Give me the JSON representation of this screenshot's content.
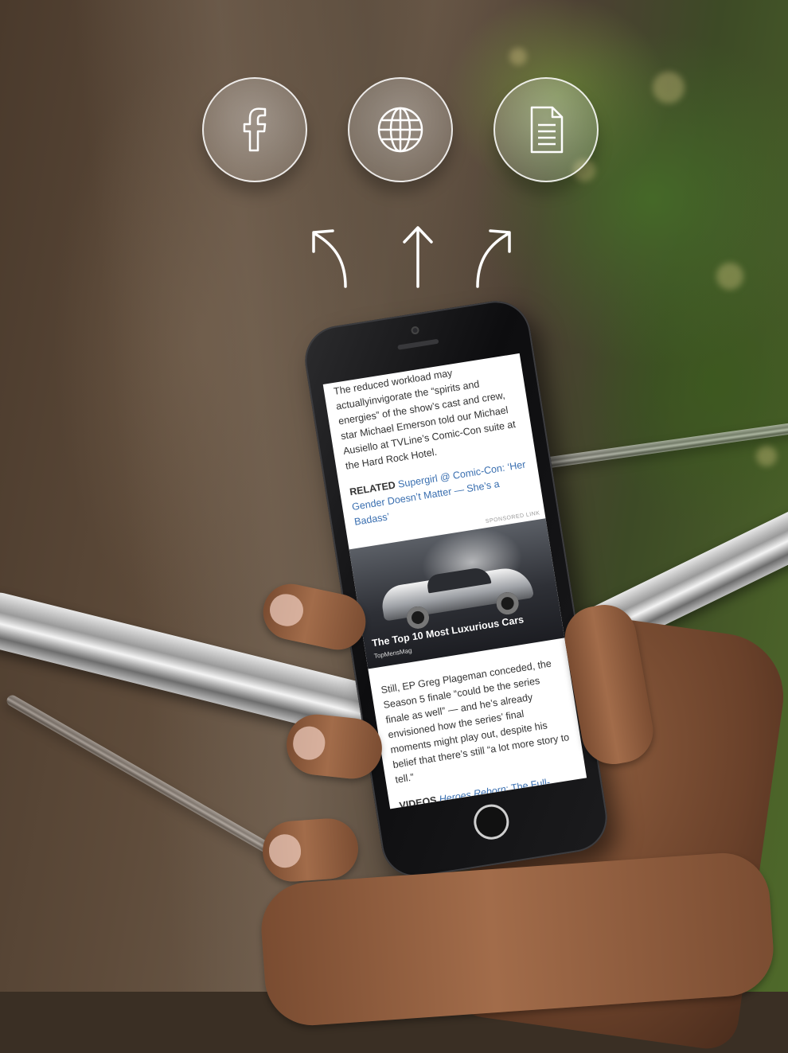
{
  "share_targets": [
    {
      "icon": "facebook-icon"
    },
    {
      "icon": "globe-icon"
    },
    {
      "icon": "document-icon"
    }
  ],
  "phone": {
    "article_top": "The reduced workload may actuallyinvigorate the “spirits and energies” of the show’s cast and crew, star Michael Emerson told our Michael Ausiello at TVLine’s Comic-Con suite at the Hard Rock Hotel.",
    "related_label": "RELATED",
    "related_link": "Supergirl @ Comic-Con: ‘Her Gender Doesn’t Matter — She’s a Badass’",
    "sponsored_label": "SPONSORED LINK",
    "promo_title": "The Top 10 Most Luxurious Cars",
    "promo_source": "TopMensMag",
    "article_bottom": "Still, EP Greg Plageman conceded, the Season 5 finale “could be the series finale as well” — and he’s already envisioned how the series’ final moments might play out, despite his belief that there’s still “a lot more story to tell.”",
    "videos_label": "VIDEOS",
    "videos_link_italic": "Heroes Reborn",
    "videos_link_rest": ": The Full-Length Trailer Has Arrived (and It’s Super-Spoilery)"
  },
  "colors": {
    "link": "#3a6fb0",
    "icon_stroke": "#ffffff"
  }
}
